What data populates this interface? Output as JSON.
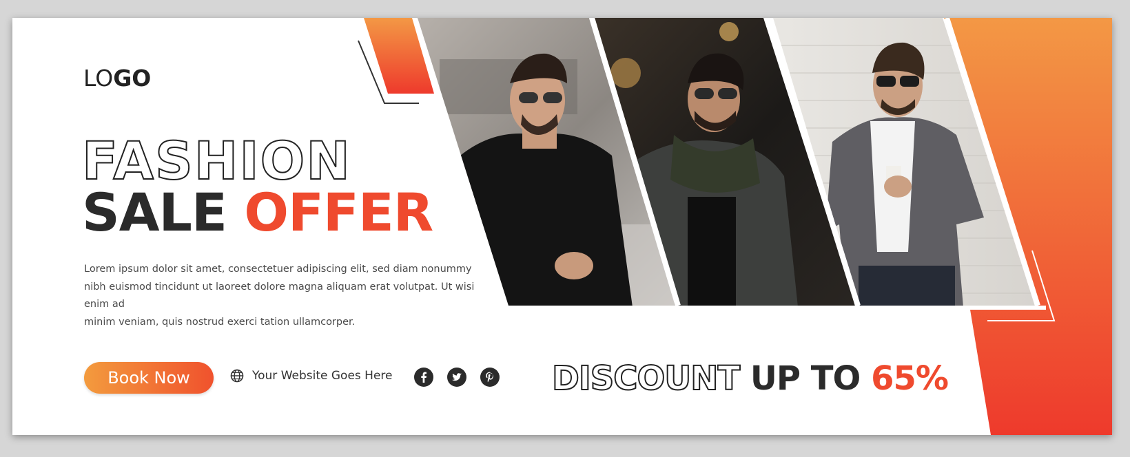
{
  "brand": {
    "logo_light": "LO",
    "logo_bold": "GO"
  },
  "headline": {
    "line1": "FASHION",
    "line2_dark": "SALE",
    "line2_accent": "OFFER"
  },
  "description": {
    "line1": "Lorem ipsum dolor sit amet, consectetuer adipiscing elit, sed diam nonummy",
    "line2": "nibh euismod tincidunt ut laoreet dolore magna aliquam erat volutpat. Ut wisi enim ad",
    "line3": "minim veniam, quis nostrud exerci tation ullamcorper."
  },
  "cta": {
    "label": "Book Now"
  },
  "website": {
    "text": "Your Website Goes Here",
    "icon": "globe-icon"
  },
  "social": [
    "facebook-icon",
    "twitter-icon",
    "pinterest-icon"
  ],
  "discount": {
    "outline": "DISCOUNT",
    "dark": "UP TO",
    "accent": "65%"
  },
  "colors": {
    "accent": "#ef4a2e",
    "gradient_start": "#f39b3e",
    "gradient_end": "#f0522d",
    "text_dark": "#2b2b2b"
  }
}
